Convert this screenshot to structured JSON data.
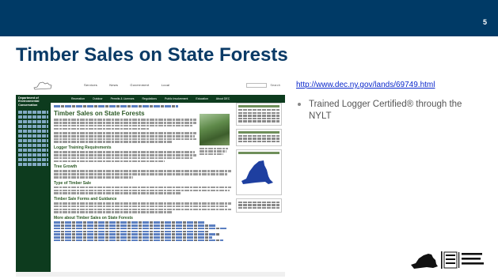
{
  "slide": {
    "number": "5",
    "title": "Timber Sales on State Forests"
  },
  "screenshot": {
    "header_nav": [
      "Services",
      "News",
      "Government",
      "Local"
    ],
    "search_label": "Search",
    "department_name": "Department of Environmental Conservation",
    "band_nav": [
      "Recreation",
      "Outdoor",
      "Permits & Licenses",
      "Regulations",
      "Public Involvement",
      "Education",
      "About DEC"
    ],
    "page_heading": "Timber Sales on State Forests",
    "section_headings": [
      "Logger Training Requirements",
      "Tree Growth",
      "Type of Timber Sale",
      "Timber Sale Forms and Guidance",
      "More about Timber Sales on State Forests"
    ]
  },
  "link": {
    "url": "http://www.dec.ny.gov/lands/69749.html"
  },
  "bullets": [
    "Trained Logger Certified® through the NYLT"
  ],
  "colors": {
    "top_bar": "#003a66",
    "title": "#0a3a66",
    "link": "#0a28cc",
    "site_green": "#0d3b1e"
  },
  "icons": {
    "logo": "nys-dec-logo"
  }
}
